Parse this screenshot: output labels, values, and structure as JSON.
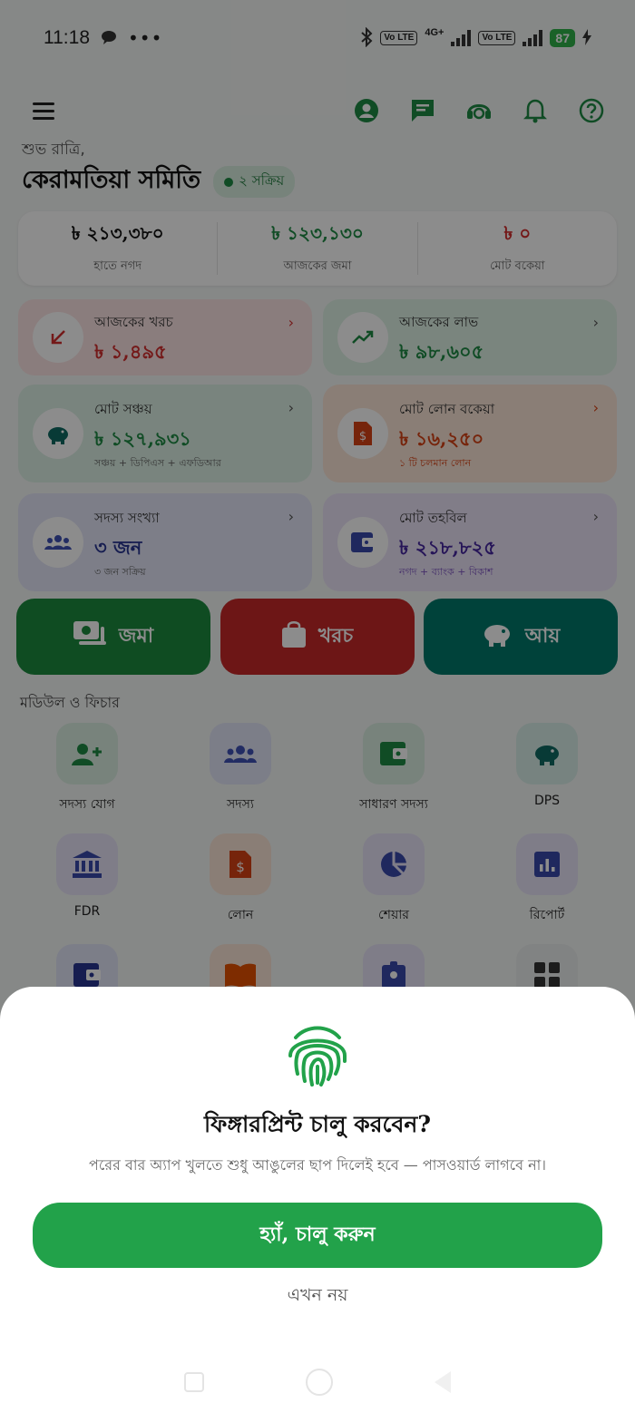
{
  "status": {
    "time": "11:18",
    "net": "4G+",
    "volte1": "Vo LTE",
    "volte2": "Vo LTE",
    "battery": "87"
  },
  "header": {
    "greeting": "শুভ রাত্রি,",
    "org_name": "কেরামতিয়া সমিতি",
    "active_badge": "২ সক্রিয়"
  },
  "summary": [
    {
      "amount": "৳ ২১৩,৩৮০",
      "label": "হাতে নগদ",
      "color": "#111111"
    },
    {
      "amount": "৳ ১২৩,১৩০",
      "label": "আজকের জমা",
      "color": "#1e8a44"
    },
    {
      "amount": "৳ ০",
      "label": "মোট বকেয়া",
      "color": "#d32f2f"
    }
  ],
  "cards": {
    "expense": {
      "title": "আজকের খরচ",
      "value": "৳ ১,৪৯৫",
      "chev": "›"
    },
    "profit": {
      "title": "আজকের লাভ",
      "value": "৳ ৯৮,৬০৫",
      "chev": "›"
    },
    "savings": {
      "title": "মোট সঞ্চয়",
      "value": "৳ ১২৭,৯৩১",
      "sub": "সঞ্চয় + ডিপিএস + এফডিআর",
      "chev": "›"
    },
    "loan": {
      "title": "মোট লোন বকেয়া",
      "value": "৳ ১৬,২৫০",
      "sub": "১ টি চলমান লোন",
      "chev": "›"
    },
    "members": {
      "title": "সদস্য সংখ্যা",
      "value": "৩ জন",
      "sub": "৩ জন সক্রিয়",
      "chev": "›"
    },
    "fund": {
      "title": "মোট তহবিল",
      "value": "৳ ২১৮,৮২৫",
      "sub": "নগদ + ব্যাংক + বিকাশ",
      "chev": "›"
    }
  },
  "actions": {
    "deposit": "জমা",
    "expense": "খরচ",
    "income": "আয়"
  },
  "modules": {
    "title": "মডিউল ও ফিচার",
    "items": [
      "সদস্য যোগ",
      "সদস্য",
      "সাধারণ সদস্য",
      "DPS",
      "FDR",
      "লোন",
      "শেয়ার",
      "রিপোর্ট"
    ]
  },
  "sheet": {
    "question": "ফিঙ্গারপ্রিন্ট চালু করবেন?",
    "description": "পরের বার অ্যাপ খুলতে শুধু আঙুলের ছাপ দিলেই হবে — পাসওয়ার্ড লাগবে না।",
    "yes_label": "হ্যাঁ, চালু করুন",
    "no_label": "এখন নয়"
  },
  "colors": {
    "primary": "#22a24a",
    "danger": "#d32f2f"
  }
}
